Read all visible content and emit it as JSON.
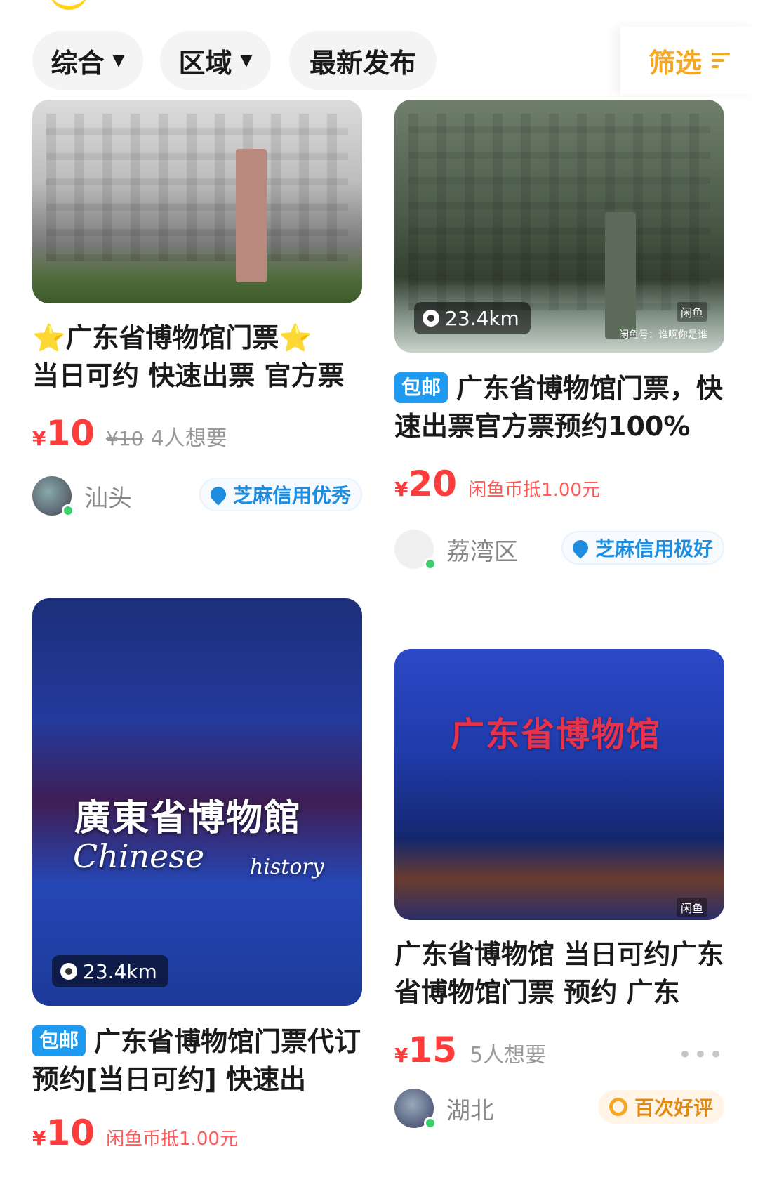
{
  "filter_bar": {
    "sort_label": "综合",
    "region_label": "区域",
    "latest_label": "最新发布",
    "filter_label": "筛选"
  },
  "cards": [
    {
      "title": "广东省博物馆门票",
      "subtitle": "当日可约 快速出票 官方票",
      "star": "⭐",
      "price_symbol": "¥",
      "price": "10",
      "old_price": "¥10",
      "want": "4人想要",
      "city": "汕头",
      "credit": "芝麻信用优秀"
    },
    {
      "distance": "23.4km",
      "tag": "包邮",
      "title": "广东省博物馆门票，快速出票官方票预约100%",
      "price_symbol": "¥",
      "price": "20",
      "coin_note": "闲鱼币抵1.00元",
      "city": "荔湾区",
      "credit": "芝麻信用极好",
      "xianyu_mark": "闲鱼",
      "xianyu_id": "闲鱼号：谁啊你是谁"
    },
    {
      "distance": "23.4km",
      "tag": "包邮",
      "title": "广东省博物馆门票代订预约[当日可约] 快速出",
      "price_symbol": "¥",
      "price": "10",
      "coin_note": "闲鱼币抵1.00元",
      "overlay_cn": "廣東省博物館",
      "overlay_en": "Chinese",
      "overlay_en2": "history"
    },
    {
      "overlay_red": "广东省博物馆",
      "title": "广东省博物馆 当日可约广东省博物馆门票 预约 广东",
      "price_symbol": "¥",
      "price": "15",
      "want": "5人想要",
      "city": "湖北",
      "badge": "百次好评",
      "xianyu_mark": "闲鱼"
    }
  ],
  "colors": {
    "accent_yellow": "#ffd21e",
    "filter_orange": "#f5a623",
    "price_red": "#ff3c3c",
    "tag_blue": "#1e9bf0"
  }
}
